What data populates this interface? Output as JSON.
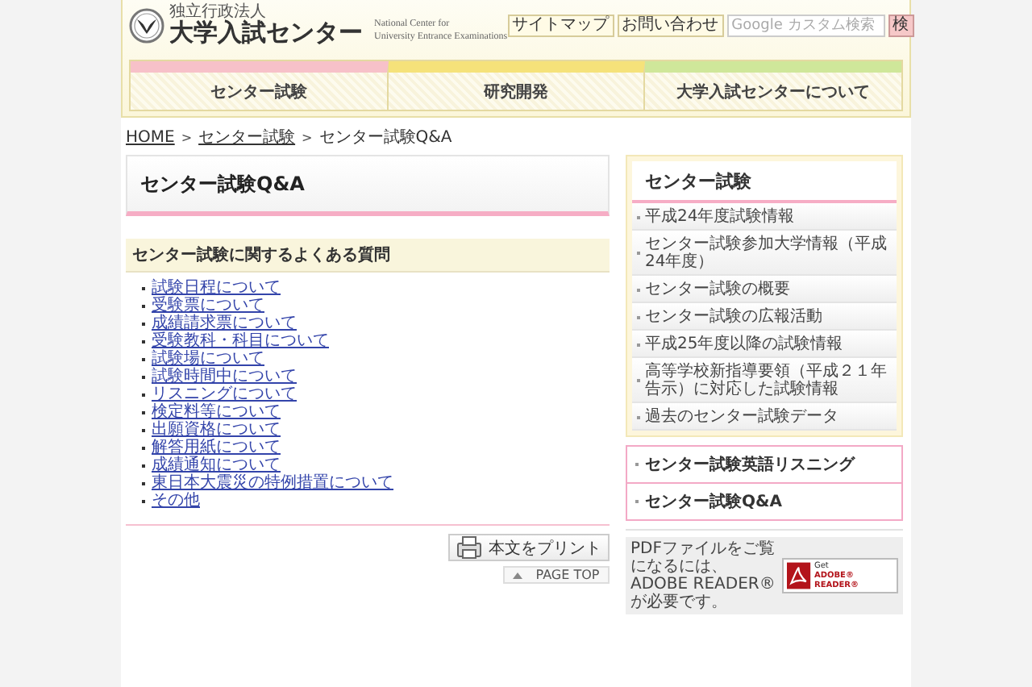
{
  "header": {
    "org_type": "独立行政法人",
    "site_name": "大学入試センター",
    "english_name": [
      "National Center for",
      "University Entrance Examinations"
    ],
    "links": [
      "サイトマップ",
      "お問い合わせ"
    ],
    "search": {
      "placeholder": "Google カスタム検索",
      "button": "検"
    }
  },
  "nav": [
    {
      "label": "センター試験",
      "color": "#f7c1c9"
    },
    {
      "label": "研究開発",
      "color": "#f5e27a"
    },
    {
      "label": "大学入試センターについて",
      "color": "#cfe79a"
    }
  ],
  "breadcrumb": {
    "separator": ">",
    "items": [
      {
        "label": "HOME",
        "link": true
      },
      {
        "label": "センター試験",
        "link": true
      },
      {
        "label": "センター試験Q&A",
        "link": false
      }
    ]
  },
  "main": {
    "title": "センター試験Q&A",
    "section_heading": "センター試験に関するよくある質問",
    "faq_links": [
      "試験日程について",
      "受験票について",
      "成績請求票について",
      "受験教科・科目について",
      "試験場について",
      "試験時間中について",
      "リスニングについて",
      "検定料等について",
      "出願資格について",
      "解答用紙について",
      "成績通知について",
      "東日本大震災の特例措置について",
      "その他"
    ],
    "print_button": "本文をプリント",
    "page_top": "PAGE TOP"
  },
  "sidebar": {
    "heading": "センター試験",
    "items": [
      "平成24年度試験情報",
      "センター試験参加大学情報（平成24年度）",
      "センター試験の概要",
      "センター試験の広報活動",
      "平成25年度以降の試験情報",
      "高等学校新指導要領（平成２１年告示）に対応した試験情報",
      "過去のセンター試験データ"
    ],
    "featured_links": [
      "センター試験英語リスニング",
      "センター試験Q&A"
    ],
    "pdf_notice": {
      "text": "PDFファイルをご覧になるには、ADOBE READER®が必要です。",
      "badge": [
        "Get",
        "ADOBE® READER®"
      ]
    }
  }
}
